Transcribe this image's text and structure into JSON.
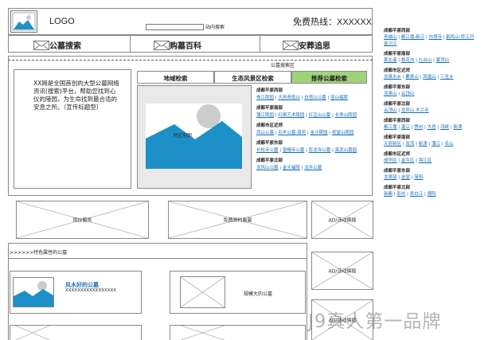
{
  "header": {
    "logo_text": "LOGO",
    "search_placeholder": "",
    "search_button": "站内搜索",
    "hotline": "免费热线：XXXXXX"
  },
  "nav": [
    {
      "label": "公墓搜索"
    },
    {
      "label": "购墓百科"
    },
    {
      "label": "安葬追思"
    }
  ],
  "search_area": {
    "title": "公墓搜索区",
    "intro": "XX网是全国首创的大型公墓网络资讯(搜索)平台，帮助您找到心仪的陵园，为生命找到最合适的安息之所。（宣传标题型）",
    "tabs": [
      {
        "label": "地域检索"
      },
      {
        "label": "生态风景区检索"
      },
      {
        "label": "推荐公墓检索"
      }
    ],
    "map_label": "地区地图",
    "regions": [
      {
        "title": "成都平原西部",
        "links": [
          "侏江陵园",
          "大邑青霞山",
          "白塔山公墓",
          "宝山福陵"
        ]
      },
      {
        "title": "成都平原南部",
        "links": [
          "蒲江陵园",
          "红枫艺术陵园",
          "红豆山公墓",
          "长寿山陵园"
        ]
      },
      {
        "title": "成都市区近郊",
        "links": [
          "凤山公墓",
          "石羊公墓·南苑",
          "金沙陵园",
          "祝堂山陵园"
        ]
      },
      {
        "title": "成都平原东部",
        "links": [
          "长松寺公墓",
          "皇帽寺公墓",
          "彭龙寺公墓",
          "真武山墓园"
        ]
      },
      {
        "title": "成都平原北部",
        "links": [
          "龙凤山公墓",
          "金光福陵",
          "龙井公墓"
        ]
      }
    ]
  },
  "sidebar": {
    "sections": [
      {
        "title": "成都平原西部",
        "lines": [
          [
            "青城山",
            "都江堰·新江",
            "白塔寺",
            "鹤鸣山·侨江河"
          ],
          [
            "金沙江"
          ]
        ]
      },
      {
        "title": "成都平原南部",
        "lines": [
          [
            "莱北溪",
            "梨花沟",
            "九台山",
            "蒙顶山"
          ]
        ]
      },
      {
        "title": "成都市区近郊",
        "lines": [
          [
            "龙泉水乡",
            "麝泉山",
            "凤凰山",
            "三圣乡"
          ]
        ]
      },
      {
        "title": "成都平原东部",
        "lines": [
          [
            "龙泉山",
            "云顶山"
          ]
        ]
      },
      {
        "title": "成都平原北部",
        "lines": [
          [
            "云顶山",
            "龙凤山·木兰寺"
          ]
        ]
      },
      {
        "title": "成都平原西部",
        "lines": [
          [
            "都江堰",
            "温江",
            "崇州",
            "大邑",
            "邛崃",
            "新津"
          ]
        ]
      },
      {
        "title": "成都平原南部",
        "lines": [
          [
            "天府新区",
            "双流",
            "新津",
            "蒲江",
            "名山"
          ]
        ]
      },
      {
        "title": "成都市区近郊",
        "lines": [
          [
            "成华区",
            "金牛区",
            "锦江区"
          ]
        ]
      },
      {
        "title": "成都平原东部",
        "lines": [
          [
            "龙泉驿",
            "金堂",
            "简阳"
          ]
        ]
      },
      {
        "title": "成都平原北部",
        "lines": [
          [
            "新都",
            "彭州",
            "青白江",
            "德阳"
          ]
        ]
      }
    ]
  },
  "banners": [
    {
      "label": "殡仪服务"
    },
    {
      "label": "免费预约看墓"
    },
    {
      "label": "AD/活动情报"
    }
  ],
  "featured": {
    "title": ">>>>>>特色属性的公墓",
    "item1_title": "风水好的公墓",
    "item1_desc": "XXXXXXXXXXXXXXXXX",
    "item2_label": "规模大的公墓"
  },
  "ads_right": [
    {
      "label": "AD/活动情报"
    },
    {
      "label": "AD/活动情报"
    }
  ],
  "watermark": "J9真人第一品牌"
}
